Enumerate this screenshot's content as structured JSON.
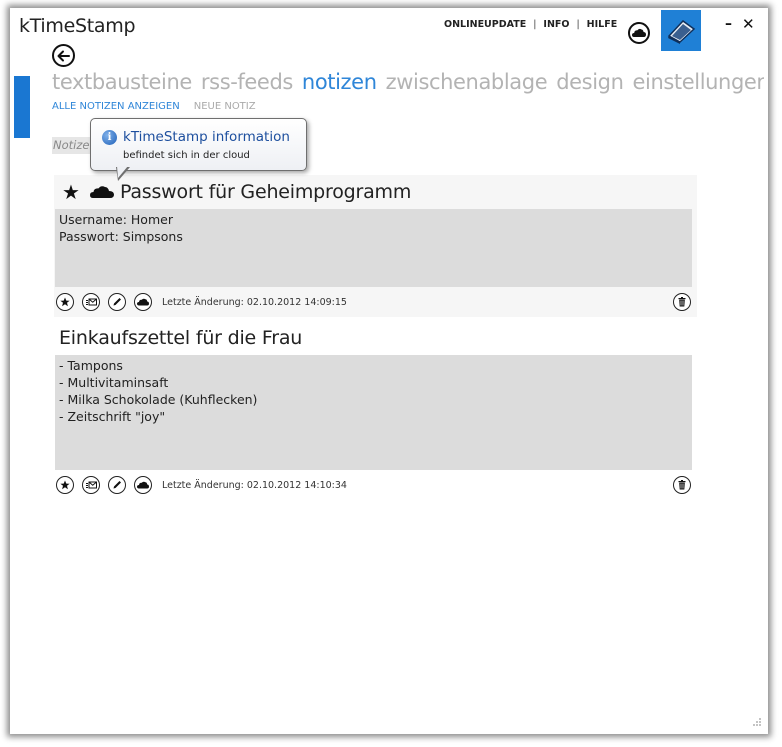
{
  "app": {
    "title": "kTimeStamp"
  },
  "topnav": {
    "items": [
      "ONLINEUPDATE",
      "INFO",
      "HILFE"
    ]
  },
  "tabs": {
    "items": [
      "textbausteine",
      "rss-feeds",
      "notizen",
      "zwischenablage",
      "design",
      "einstellungen"
    ],
    "active": "notizen"
  },
  "subnav": {
    "show_all": "ALLE NOTIZEN ANZEIGEN",
    "new_note": "NEUE NOTIZ"
  },
  "filter": {
    "placeholder": "Notizen"
  },
  "tooltip": {
    "icon": "info-icon",
    "title": "kTimeStamp information",
    "body": "befindet sich in der cloud"
  },
  "notes": [
    {
      "title": "Passwort für Geheimprogramm",
      "starred": true,
      "in_cloud": true,
      "lines": [
        "Username: Homer",
        "Passwort: Simpsons"
      ],
      "meta": "Letzte Änderung: 02.10.2012 14:09:15"
    },
    {
      "title": "Einkaufszettel für die Frau",
      "starred": false,
      "in_cloud": false,
      "lines": [
        "- Tampons",
        "- Multivitaminsaft",
        "- Milka Schokolade (Kuhflecken)",
        "- Zeitschrift \"joy\""
      ],
      "meta": "Letzte Änderung: 02.10.2012 14:10:34"
    }
  ],
  "colors": {
    "accent": "#2f86d8",
    "brand_tile": "#1f80d6",
    "inactive_tab": "#b3b3b3",
    "note_body_bg": "#dcdcdc"
  }
}
